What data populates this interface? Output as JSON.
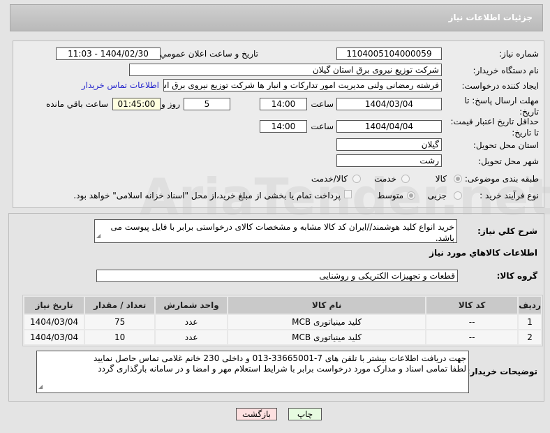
{
  "header": {
    "title": "جزئیات اطلاعات نیاز"
  },
  "form": {
    "need_number_label": "شماره نیاز:",
    "need_number": "1104005104000059",
    "announce_label": "تاريخ و ساعت اعلان عمومي:",
    "announce_value": "1404/02/30 - 11:03",
    "buyer_label": "نام دستگاه خریدار:",
    "buyer": "شرکت توزیع نیروی برق استان گیلان",
    "creator_label": "ایجاد کننده درخواست:",
    "creator": "فرشته رمضانی ولنی مدیریت امور تدارکات و انبار ها شرکت توزیع نیروی برق استا",
    "contact_link": "اطلاعات تماس خریدار",
    "deadline_label": "مهلت ارسال پاسخ: تا تاریخ:",
    "deadline_date": "1404/03/04",
    "time_label": "ساعت",
    "deadline_time": "14:00",
    "days": "5",
    "days_label": "روز و",
    "remaining": "01:45:00",
    "remaining_label": "ساعت باقي مانده",
    "validity_label": "حداقل تاریخ اعتبار قیمت: تا تاریخ:",
    "validity_date": "1404/04/04",
    "validity_time": "14:00",
    "province_label": "استان محل تحویل:",
    "province": "گیلان",
    "city_label": "شهر محل تحویل:",
    "city": "رشت",
    "category_label": "طبقه بندی موضوعی:",
    "category_options": [
      "کالا",
      "خدمت",
      "کالا/خدمت"
    ],
    "process_label": "نوع فرآیند خرید :",
    "process_options": [
      "جزیی",
      "متوسط"
    ],
    "payment_note": "پرداخت تمام یا بخشی از مبلغ خرید،از محل \"اسناد خزانه اسلامی\" خواهد بود."
  },
  "details": {
    "description_label": "شرح کلي نیاز:",
    "description": "خرید انواع کلید هوشمند//ایران کد کالا مشابه و مشخصات کالای درخواستی برابر با فایل پیوست می باشد.",
    "goods_heading": "اطلاعات کالاهاي مورد نیاز",
    "group_label": "گروه کالا:",
    "group": "قطعات و تجهیزات الکتریکی و روشنایی",
    "table": {
      "headers": [
        "ردیف",
        "کد کالا",
        "نام کالا",
        "واحد شمارش",
        "تعداد / مقدار",
        "تاریخ نیاز"
      ],
      "rows": [
        [
          "1",
          "--",
          "کلید مینیاتوری MCB",
          "عدد",
          "75",
          "1404/03/04"
        ],
        [
          "2",
          "--",
          "کلید مینیاتوری MCB",
          "عدد",
          "10",
          "1404/03/04"
        ]
      ]
    },
    "notes_label": "توضیحات خریدار:",
    "notes_line1": "جهت دریافت اطلاعات بیشتر با تلفن های 7-33665001-013 و داخلی 230 خانم غلامی تماس حاصل نمایید",
    "notes_line2": "لطفا تمامی اسناد و مدارک مورد درخواست برابر با شرایط استعلام مهر و امضا و در سامانه بارگذاری گردد"
  },
  "buttons": {
    "back": "بازگشت",
    "print": "چاپ"
  },
  "watermark": "AriaTender.net"
}
